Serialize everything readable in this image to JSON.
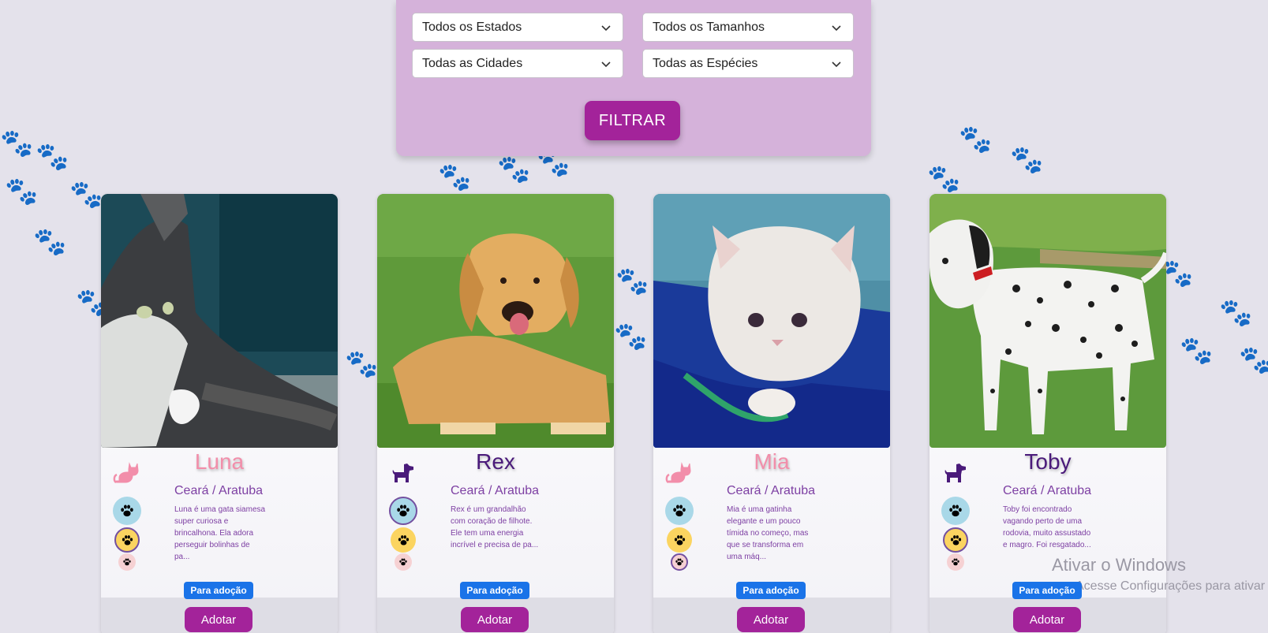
{
  "filters": {
    "state_select": "Todos os Estados",
    "size_select": "Todos os Tamanhos",
    "city_select": "Todas as Cidades",
    "species_select": "Todas as Espécies",
    "filter_button": "FILTRAR"
  },
  "colors": {
    "brand": "#a3239a",
    "panel": "#d5b2da",
    "cat_pink": "#f28eaa",
    "dog_purple": "#4a1a7a",
    "badge_blue": "#1a73e8"
  },
  "pets": [
    {
      "name": "Luna",
      "species_icon": "cat-icon",
      "location": "Ceará / Aratuba",
      "description": "Luna é uma gata siamesa super curiosa e brincalhona. Ela adora perseguir bolinhas de pa...",
      "badge": "Para adoção",
      "adopt_label": "Adotar",
      "selected_trait": 2
    },
    {
      "name": "Rex",
      "species_icon": "dog-icon",
      "location": "Ceará / Aratuba",
      "description": "Rex é um grandalhão com coração de filhote. Ele tem uma energia incrível e precisa de pa...",
      "badge": "Para adoção",
      "adopt_label": "Adotar",
      "selected_trait": 1
    },
    {
      "name": "Mia",
      "species_icon": "cat-icon",
      "location": "Ceará / Aratuba",
      "description": "Mia é uma gatinha elegante e um pouco tímida no começo, mas que se transforma em uma máq...",
      "badge": "Para adoção",
      "adopt_label": "Adotar",
      "selected_trait": 3
    },
    {
      "name": "Toby",
      "species_icon": "dog-icon",
      "location": "Ceará / Aratuba",
      "description": "Toby foi encontrado vagando perto de uma rodovia, muito assustado e magro. Foi resgatado...",
      "badge": "Para adoção",
      "adopt_label": "Adotar",
      "selected_trait": 2
    }
  ],
  "watermark": {
    "line1": "Ativar o Windows",
    "line2": "Acesse Configurações para ativar o"
  }
}
